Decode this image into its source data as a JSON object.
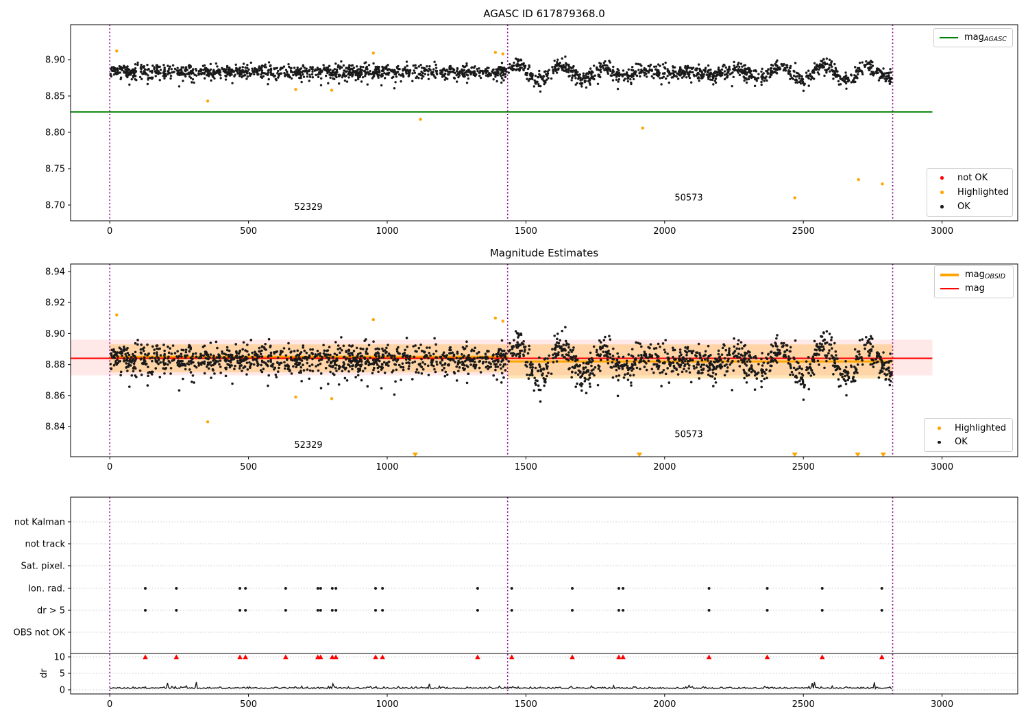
{
  "colors": {
    "green": "#008000",
    "orange": "#ffa500",
    "red": "#ff0000",
    "black": "#1a1a1a",
    "vline": "#8b008b",
    "band_red": "rgba(255,0,0,0.09)",
    "band_orange": "rgba(255,165,0,0.28)",
    "grid": "#c9c9c9",
    "frame": "#000000"
  },
  "chart_data": [
    {
      "type": "scatter",
      "title": "AGASC ID 617879368.0",
      "xlabel": "",
      "ylabel": "",
      "xlim": [
        -141,
        3273
      ],
      "ylim": [
        8.678,
        8.948
      ],
      "xticks": [
        0,
        500,
        1000,
        1500,
        2000,
        2500,
        3000
      ],
      "yticks": [
        8.9,
        8.85,
        8.8,
        8.75,
        8.7
      ],
      "grid": false,
      "vlines": {
        "x": [
          0,
          1434,
          2822
        ],
        "color": "#8b008b",
        "style": "dotted"
      },
      "agasc_mag_line": {
        "value": 8.828,
        "color": "#008000",
        "x_start": -141,
        "x_end": 2965
      },
      "annotations": [
        {
          "text": "52329",
          "x": 716,
          "y": 8.697
        },
        {
          "text": "50573",
          "x": 2087,
          "y": 8.71
        }
      ],
      "legend_line": {
        "position": "upper right",
        "items": [
          {
            "label": "mag",
            "sub": "AGASC",
            "color": "#008000"
          }
        ]
      },
      "legend_markers": {
        "position": "lower right",
        "items": [
          {
            "label": "not OK",
            "color": "#ff0000"
          },
          {
            "label": "Highlighted",
            "color": "#ffa500"
          },
          {
            "label": "OK",
            "color": "#1a1a1a"
          }
        ]
      },
      "highlighted_points": [
        [
          25,
          8.912
        ],
        [
          353,
          8.843
        ],
        [
          670,
          8.859
        ],
        [
          800,
          8.858
        ],
        [
          950,
          8.909
        ],
        [
          1120,
          8.818
        ],
        [
          1390,
          8.91
        ],
        [
          1417,
          8.908
        ],
        [
          1921,
          8.806
        ],
        [
          2469,
          8.71
        ],
        [
          2699,
          8.735
        ],
        [
          2785,
          8.729
        ]
      ],
      "ok_points_summary": "dense cloud mean 8.884, sd 0.005, x 0-1434 flat; x 1434-2822 oscillating amplitude ~0.01 period ~158",
      "scatter_model": {
        "seed": 42,
        "segments": [
          {
            "n": 1150,
            "x0": 2,
            "x1": 1430,
            "mean": 8.8835,
            "noise": 0.0046,
            "low_frac": 0.035,
            "low_max": 0.017,
            "high_frac": 0.007,
            "high_max": 0.012
          },
          {
            "n": 1100,
            "x0": 1436,
            "x1": 2820,
            "mean": 8.8825,
            "noise": 0.0048,
            "wave_amp": 0.0105,
            "wave_period": 158,
            "wave_phase_x": 1470,
            "env_period": 1100,
            "env_center": 1250,
            "low_frac": 0.05,
            "low_max": 0.015
          }
        ]
      }
    },
    {
      "type": "scatter",
      "title": "Magnitude Estimates",
      "xlim": [
        -141,
        3273
      ],
      "ylim": [
        8.8205,
        8.9449
      ],
      "xticks": [
        0,
        500,
        1000,
        1500,
        2000,
        2500,
        3000
      ],
      "yticks": [
        8.94,
        8.92,
        8.9,
        8.88,
        8.86,
        8.84
      ],
      "grid": false,
      "vlines": {
        "x": [
          0,
          1434,
          2822
        ],
        "color": "#8b008b",
        "style": "dotted"
      },
      "mag_line": {
        "label": "mag",
        "value": 8.884,
        "color": "#ff0000",
        "band": [
          8.873,
          8.896
        ],
        "x_start": -141,
        "x_end": 2965
      },
      "obsid_lines": [
        {
          "obsid": "52329",
          "x0": 0,
          "x1": 1434,
          "value": 8.885,
          "band": [
            8.875,
            8.893
          ]
        },
        {
          "obsid": "50573",
          "x0": 1434,
          "x1": 2822,
          "value": 8.882,
          "band": [
            8.871,
            8.893
          ]
        }
      ],
      "clipped_low_marker_x": [
        1101,
        1909,
        2469,
        2696,
        2788
      ],
      "annotations": [
        {
          "text": "52329",
          "x": 716,
          "y": 8.828
        },
        {
          "text": "50573",
          "x": 2087,
          "y": 8.835
        }
      ],
      "legend_line": {
        "position": "upper right",
        "items": [
          {
            "label": "mag",
            "sub": "OBSID",
            "color": "#ffa500"
          },
          {
            "label": "mag",
            "sub": "",
            "color": "#ff0000"
          }
        ]
      },
      "legend_markers": {
        "position": "lower right",
        "items": [
          {
            "label": "Highlighted",
            "color": "#ffa500"
          },
          {
            "label": "OK",
            "color": "#1a1a1a"
          }
        ]
      }
    },
    {
      "type": "scatter",
      "title": "",
      "xlim": [
        -141,
        3273
      ],
      "xticks": [
        0,
        500,
        1000,
        1500,
        2000,
        2500,
        3000
      ],
      "rows": [
        "not Kalman",
        "not track",
        "Sat. pixel.",
        "Ion. rad.",
        "dr > 5",
        "OBS not OK"
      ],
      "flag_rows": [
        "Ion. rad.",
        "dr > 5"
      ],
      "flags_x": [
        128,
        240,
        469,
        489,
        634,
        750,
        760,
        802,
        815,
        958,
        983,
        1326,
        1449,
        1667,
        1835,
        1850,
        2160,
        2370,
        2568,
        2783
      ],
      "dr_clipped_x": [
        128,
        240,
        469,
        489,
        634,
        750,
        760,
        802,
        815,
        958,
        983,
        1326,
        1449,
        1667,
        1835,
        1850,
        2160,
        2370,
        2568,
        2783
      ],
      "dr_axis": {
        "label": "dr",
        "ticks": [
          10,
          5,
          0
        ],
        "separator_above": 10
      },
      "vlines": {
        "x": [
          0,
          1434,
          2822
        ],
        "color": "#8b008b",
        "style": "dotted"
      },
      "grid": true,
      "dr_model": {
        "x0": 0,
        "x1": 2820,
        "step": 4,
        "base": 0.38,
        "noise": 0.26,
        "spike_frac": 0.012,
        "spike_max": 1.6
      }
    }
  ]
}
